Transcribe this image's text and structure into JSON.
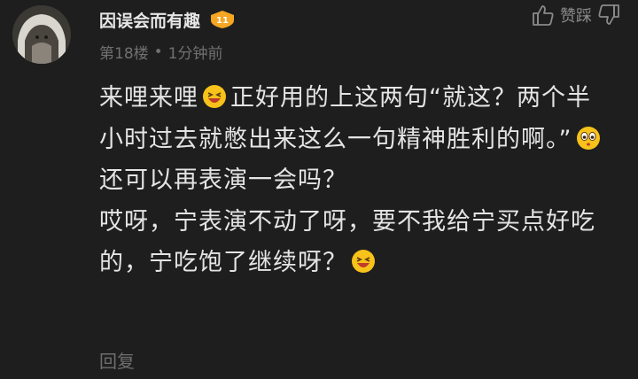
{
  "comment": {
    "username": "因误会而有趣",
    "level": "11",
    "floor": "第18楼",
    "separator": "•",
    "time": "1分钟前",
    "vote_label": "赞踩",
    "body": {
      "p1": "来哩来哩",
      "p2": "正好用的上这两句“就这？两个半小时过去就憋出来这么一句精神胜利的啊。”",
      "p3": "还可以再表演一会吗？",
      "p4": "哎呀，宁表演不动了呀，要不我给宁买点好吃的，宁吃饱了继续呀？"
    },
    "emojis": [
      "laughing-emoji",
      "surprised-emoji",
      "laughing-emoji"
    ],
    "reply_label": "回复"
  },
  "colors": {
    "background": "#1e1e1e",
    "text": "#e4e4e4",
    "muted": "#707070",
    "badge": "#f5a623"
  }
}
